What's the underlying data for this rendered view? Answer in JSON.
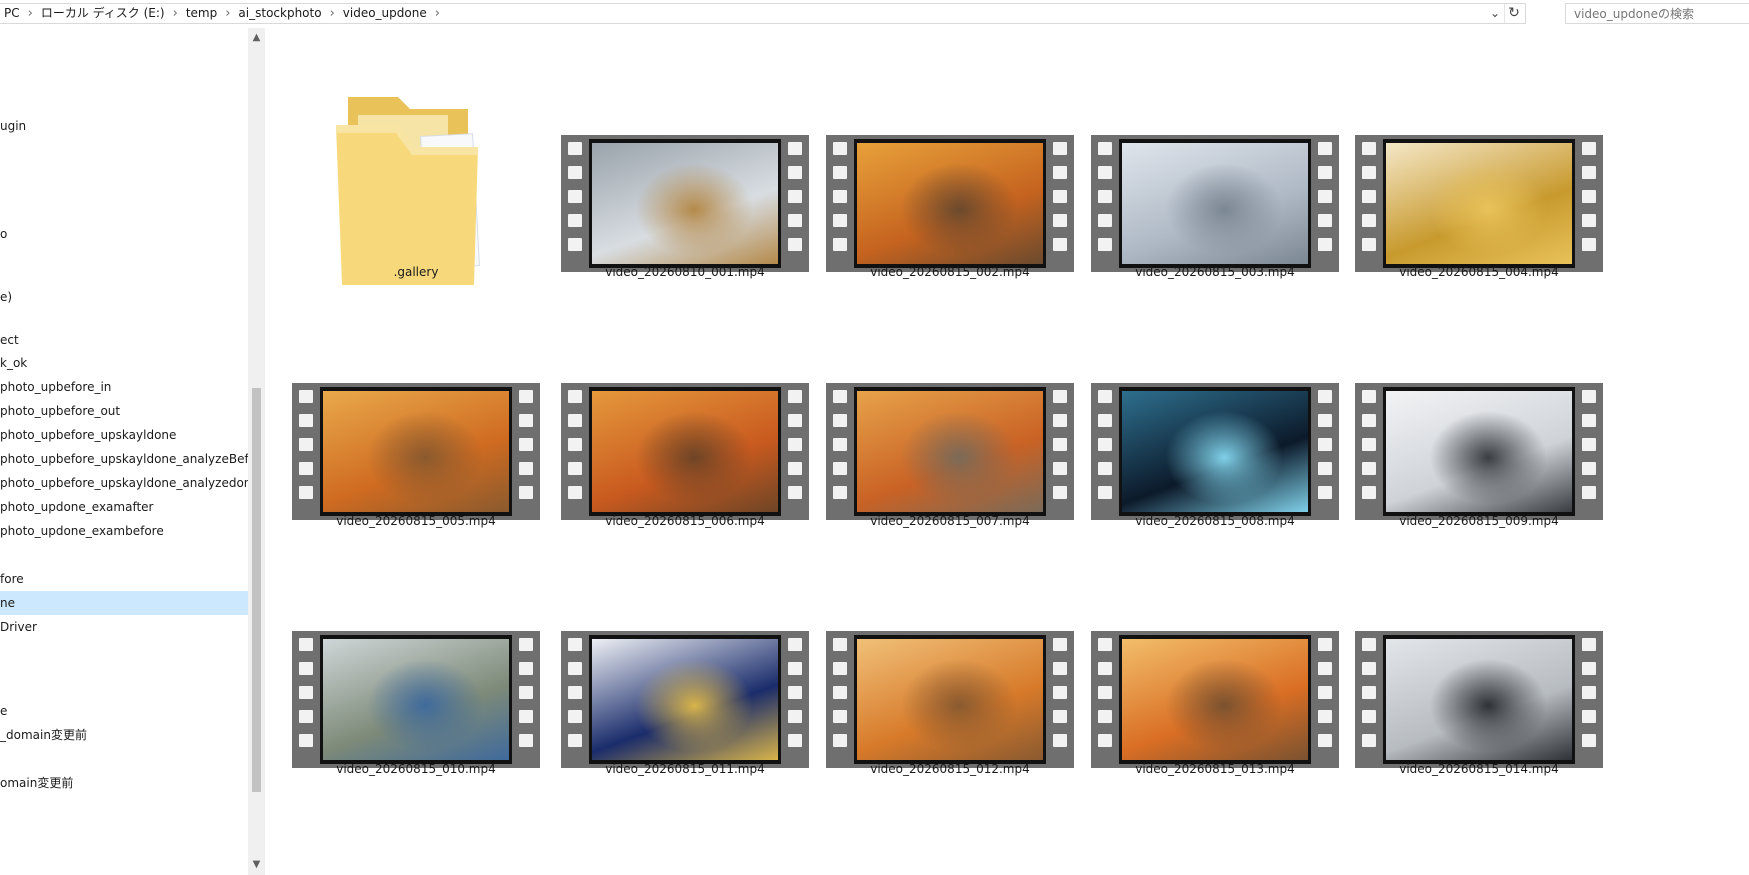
{
  "breadcrumb": {
    "items": [
      "PC",
      "ローカル ディスク (E:)",
      "temp",
      "ai_stockphoto",
      "video_updone"
    ]
  },
  "search": {
    "placeholder": "video_updoneの検索"
  },
  "nav": {
    "items": [
      {
        "label": "ugin"
      },
      {
        "label": "o"
      },
      {
        "label": "e)"
      },
      {
        "label": "ect"
      },
      {
        "label": "k_ok"
      },
      {
        "label": "photo_upbefore_in"
      },
      {
        "label": "photo_upbefore_out"
      },
      {
        "label": "photo_upbefore_upskayldone"
      },
      {
        "label": "photo_upbefore_upskayldone_analyzeBefore"
      },
      {
        "label": "photo_upbefore_upskayldone_analyzedone"
      },
      {
        "label": "photo_updone_examafter"
      },
      {
        "label": "photo_updone_exambefore"
      },
      {
        "label": "fore"
      },
      {
        "label": "ne",
        "selected": true
      },
      {
        "label": "Driver"
      },
      {
        "label": "e"
      },
      {
        "label": "_domain変更前"
      },
      {
        "label": "omain変更前"
      }
    ]
  },
  "files": [
    {
      "name": ".gallery",
      "type": "folder"
    },
    {
      "name": "video_20260810_001.mp4",
      "type": "video",
      "palette": [
        "#d8dde2",
        "#9aa3ab",
        "#b58a4a"
      ]
    },
    {
      "name": "video_20260815_002.mp4",
      "type": "video",
      "palette": [
        "#c5631f",
        "#e8a13a",
        "#6b4a2e"
      ]
    },
    {
      "name": "video_20260815_003.mp4",
      "type": "video",
      "palette": [
        "#aeb8c4",
        "#dfe5ec",
        "#7c8794"
      ]
    },
    {
      "name": "video_20260815_004.mp4",
      "type": "video",
      "palette": [
        "#c89a2e",
        "#f4e7c7",
        "#e8c25a"
      ]
    },
    {
      "name": "video_20260815_005.mp4",
      "type": "video",
      "palette": [
        "#cf6b21",
        "#e9a94b",
        "#8a5a2e"
      ]
    },
    {
      "name": "video_20260815_006.mp4",
      "type": "video",
      "palette": [
        "#c95a1f",
        "#e5983c",
        "#6e4526"
      ]
    },
    {
      "name": "video_20260815_007.mp4",
      "type": "video",
      "palette": [
        "#c96225",
        "#e7a24a",
        "#7a6a58"
      ]
    },
    {
      "name": "video_20260815_008.mp4",
      "type": "video",
      "palette": [
        "#0c1a2a",
        "#2e6f8e",
        "#7fd0e8"
      ]
    },
    {
      "name": "video_20260815_009.mp4",
      "type": "video",
      "palette": [
        "#cfd3d8",
        "#f2f3f5",
        "#3a3d42"
      ]
    },
    {
      "name": "video_20260815_010.mp4",
      "type": "video",
      "palette": [
        "#7d8a78",
        "#cfd6d8",
        "#3f6a9c"
      ]
    },
    {
      "name": "video_20260815_011.mp4",
      "type": "video",
      "palette": [
        "#1a2c6b",
        "#eef0f4",
        "#d9b44a"
      ]
    },
    {
      "name": "video_20260815_012.mp4",
      "type": "video",
      "palette": [
        "#d77a2a",
        "#f0c078",
        "#8a5a30"
      ]
    },
    {
      "name": "video_20260815_013.mp4",
      "type": "video",
      "palette": [
        "#d96e24",
        "#f2be6a",
        "#7a5230"
      ]
    },
    {
      "name": "video_20260815_014.mp4",
      "type": "video",
      "palette": [
        "#b7bcc1",
        "#e3e6e9",
        "#2f3338"
      ]
    }
  ],
  "colors": {
    "selected_bg": "#cce8ff",
    "film_strip": "#6f6f6f"
  }
}
